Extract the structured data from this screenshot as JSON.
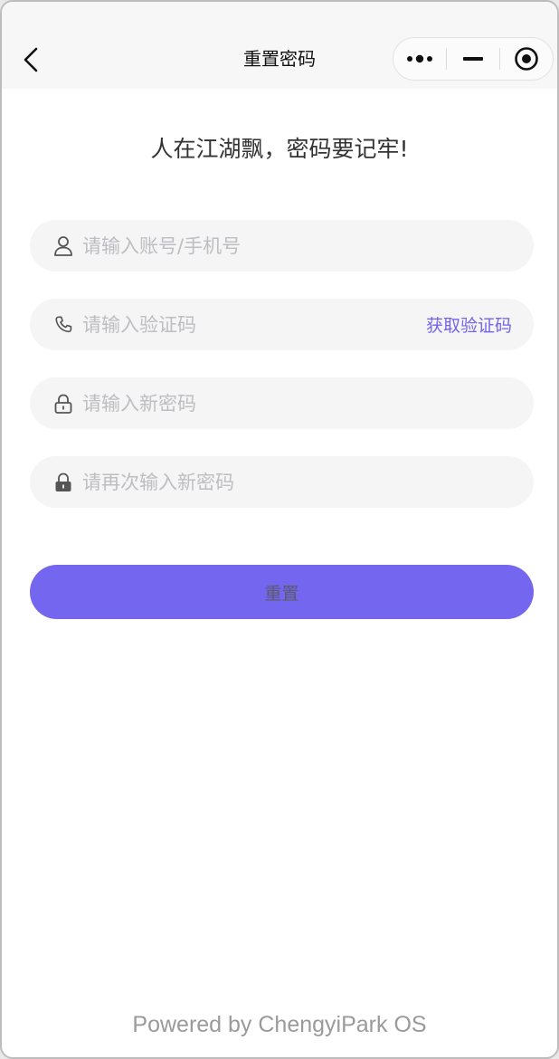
{
  "navbar": {
    "title": "重置密码",
    "back_icon": "chevron-left-icon",
    "capsule": {
      "more_icon": "more-dots-icon",
      "minimize_icon": "minimize-icon",
      "close_icon": "target-close-icon"
    }
  },
  "form": {
    "slogan": "人在江湖飘，密码要记牢!",
    "account": {
      "icon": "user-icon",
      "placeholder": "请输入账号/手机号",
      "value": ""
    },
    "code": {
      "icon": "phone-icon",
      "placeholder": "请输入验证码",
      "value": "",
      "action_label": "获取验证码"
    },
    "new_password": {
      "icon": "lock-open-icon",
      "placeholder": "请输入新密码",
      "value": ""
    },
    "confirm_password": {
      "icon": "lock-filled-icon",
      "placeholder": "请再次输入新密码",
      "value": ""
    },
    "submit_label": "重置"
  },
  "footer": {
    "text": "Powered by ChengyiPark OS"
  },
  "colors": {
    "accent": "#7466ee",
    "link": "#7364ea",
    "field_bg": "#f5f5f5",
    "placeholder": "#bdbdc2"
  }
}
